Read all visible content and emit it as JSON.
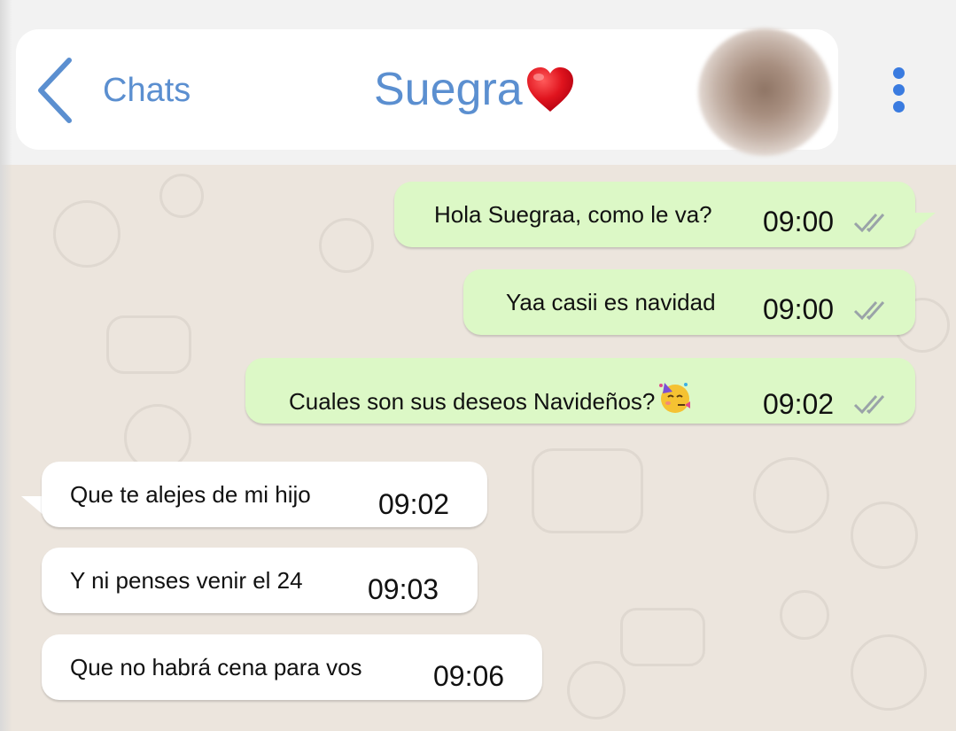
{
  "header": {
    "back_label": "Chats",
    "contact_name": "Suegra",
    "title_icon": "red-heart-icon",
    "avatar": "blurred-profile-photo",
    "menu_icon": "kebab-menu-icon"
  },
  "colors": {
    "accent": "#5b8fd0",
    "menu_dots": "#3a7be0",
    "outgoing_bubble": "#dcf8c6",
    "incoming_bubble": "#ffffff",
    "chat_background": "#ece5dd",
    "heart": "#e0141e",
    "ticks": "#9aa3a8"
  },
  "messages": [
    {
      "direction": "outgoing",
      "text": "Hola Suegraa, como le va?",
      "time": "09:00",
      "status_icon": "double-check-icon"
    },
    {
      "direction": "outgoing",
      "text": "Yaa casii es navidad",
      "time": "09:00",
      "status_icon": "double-check-icon"
    },
    {
      "direction": "outgoing",
      "text": "Cuales son sus deseos Navideños?",
      "emoji": "partying-face-emoji",
      "time": "09:02",
      "status_icon": "double-check-icon"
    },
    {
      "direction": "incoming",
      "text": "Que te alejes de mi hijo",
      "time": "09:02"
    },
    {
      "direction": "incoming",
      "text": "Y ni penses venir el 24",
      "time": "09:03"
    },
    {
      "direction": "incoming",
      "text": "Que no habrá cena para vos",
      "time": "09:06"
    }
  ]
}
